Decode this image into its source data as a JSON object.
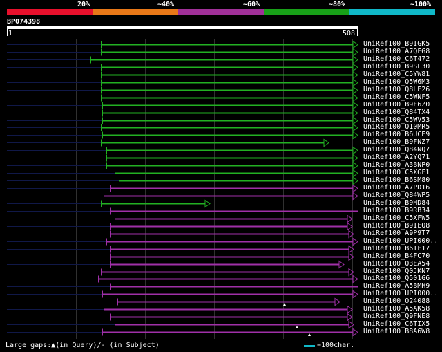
{
  "legend": [
    {
      "label": "20%",
      "color": "#e8102c"
    },
    {
      "label": "~40%",
      "color": "#e87818"
    },
    {
      "label": "~60%",
      "color": "#a03098"
    },
    {
      "label": "~80%",
      "color": "#18a018"
    },
    {
      "label": "~100%",
      "color": "#10b8c8"
    }
  ],
  "query": {
    "name": "BP074398",
    "start_label": "1",
    "end_label": "508"
  },
  "footer": {
    "gaps_text": "Large gaps:▲(in Query)/- (in Subject)",
    "scale_label": "=100char."
  },
  "colors": {
    "green": "#22b022",
    "purple": "#a030a8",
    "line": "#101848",
    "grid": "#303030"
  },
  "hits": [
    {
      "label": "UniRef100_B9IGK5",
      "color": "green",
      "start": 136,
      "end": 508,
      "arrow": true
    },
    {
      "label": "UniRef100_A7QFG8",
      "color": "green",
      "start": 136,
      "end": 508,
      "arrow": true
    },
    {
      "label": "UniRef100_C6T472",
      "color": "green",
      "start": 121,
      "end": 508,
      "arrow": true
    },
    {
      "label": "UniRef100_B9SL30",
      "color": "green",
      "start": 136,
      "end": 508,
      "arrow": true
    },
    {
      "label": "UniRef100_C5YW81",
      "color": "green",
      "start": 136,
      "end": 508,
      "arrow": true
    },
    {
      "label": "UniRef100_Q5W6M3",
      "color": "green",
      "start": 136,
      "end": 508,
      "arrow": true
    },
    {
      "label": "UniRef100_Q8LE26",
      "color": "green",
      "start": 136,
      "end": 508,
      "arrow": true
    },
    {
      "label": "UniRef100_C5WNF5",
      "color": "green",
      "start": 136,
      "end": 508,
      "arrow": true
    },
    {
      "label": "UniRef100_B9F6Z0",
      "color": "green",
      "start": 138,
      "end": 508,
      "arrow": true
    },
    {
      "label": "UniRef100_Q84TX4",
      "color": "green",
      "start": 138,
      "end": 508,
      "arrow": true
    },
    {
      "label": "UniRef100_C5WV53",
      "color": "green",
      "start": 138,
      "end": 508,
      "arrow": true
    },
    {
      "label": "UniRef100_Q10MR5",
      "color": "green",
      "start": 136,
      "end": 508,
      "arrow": true
    },
    {
      "label": "UniRef100_B6UCE9",
      "color": "green",
      "start": 138,
      "end": 508,
      "arrow": true
    },
    {
      "label": "UniRef100_B9FNZ7",
      "color": "green",
      "start": 136,
      "end": 466,
      "arrow": true
    },
    {
      "label": "UniRef100_Q84NQ7",
      "color": "green",
      "start": 144,
      "end": 508,
      "arrow": true
    },
    {
      "label": "UniRef100_A2YQ71",
      "color": "green",
      "start": 144,
      "end": 508,
      "arrow": true
    },
    {
      "label": "UniRef100_A3BNP0",
      "color": "green",
      "start": 144,
      "end": 508,
      "arrow": true
    },
    {
      "label": "UniRef100_C5XGF1",
      "color": "green",
      "start": 156,
      "end": 508,
      "arrow": true
    },
    {
      "label": "UniRef100_B6SM80",
      "color": "green",
      "start": 162,
      "end": 508,
      "arrow": true
    },
    {
      "label": "UniRef100_A7PD16",
      "color": "purple",
      "start": 150,
      "end": 508,
      "arrow": true
    },
    {
      "label": "UniRef100_Q84WP5",
      "color": "purple",
      "start": 140,
      "end": 508,
      "arrow": true
    },
    {
      "label": "UniRef100_B9HD84",
      "color": "green",
      "start": 136,
      "end": 294,
      "arrow": true
    },
    {
      "label": "UniRef100_B9RB34",
      "color": "purple",
      "start": 150,
      "end": 508,
      "arrow": false
    },
    {
      "label": "UniRef100_C5XFW5",
      "color": "purple",
      "start": 156,
      "end": 500,
      "arrow": true
    },
    {
      "label": "UniRef100_B9IEQ8",
      "color": "purple",
      "start": 150,
      "end": 500,
      "arrow": true
    },
    {
      "label": "UniRef100_A9P9T7",
      "color": "purple",
      "start": 150,
      "end": 502,
      "arrow": true
    },
    {
      "label": "UniRef100_UPI000..",
      "color": "purple",
      "start": 144,
      "end": 508,
      "arrow": true
    },
    {
      "label": "UniRef100_B6TF17",
      "color": "purple",
      "start": 150,
      "end": 502,
      "arrow": true
    },
    {
      "label": "UniRef100_B4FC70",
      "color": "purple",
      "start": 150,
      "end": 502,
      "arrow": true
    },
    {
      "label": "UniRef100_Q3EA54",
      "color": "purple",
      "start": 150,
      "end": 488,
      "arrow": true
    },
    {
      "label": "UniRef100_Q0JKN7",
      "color": "purple",
      "start": 136,
      "end": 502,
      "arrow": true
    },
    {
      "label": "UniRef100_Q501G6",
      "color": "purple",
      "start": 132,
      "end": 508,
      "arrow": true
    },
    {
      "label": "UniRef100_A5BMH9",
      "color": "purple",
      "start": 150,
      "end": 508,
      "arrow": false
    },
    {
      "label": "UniRef100_UPI000..",
      "color": "purple",
      "start": 138,
      "end": 508,
      "arrow": true
    },
    {
      "label": "UniRef100_O24088",
      "color": "purple",
      "start": 160,
      "end": 482,
      "arrow": true
    },
    {
      "label": "UniRef100_A5AK58",
      "color": "purple",
      "start": 140,
      "end": 500,
      "arrow": true
    },
    {
      "label": "UniRef100_Q9FNE8",
      "color": "purple",
      "start": 150,
      "end": 500,
      "arrow": true
    },
    {
      "label": "UniRef100_C6TIX5",
      "color": "purple",
      "start": 156,
      "end": 502,
      "arrow": true
    },
    {
      "label": "UniRef100_B8A6W8",
      "color": "purple",
      "start": 138,
      "end": 508,
      "arrow": true
    }
  ],
  "query_gaps": [
    {
      "row": 34,
      "pos": 402
    },
    {
      "row": 37,
      "pos": 420
    },
    {
      "row": 38,
      "pos": 438
    }
  ]
}
